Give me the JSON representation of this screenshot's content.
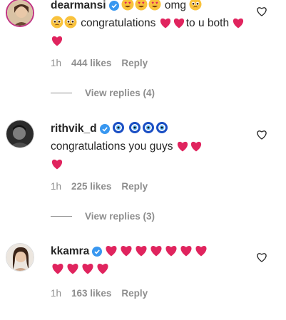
{
  "comments": [
    {
      "username": "dearmansi",
      "segments": [
        " omg ",
        " congratulations ",
        "to u both "
      ],
      "time": "1h",
      "likes": "444 likes",
      "reply": "Reply",
      "view_replies": "View replies (4)"
    },
    {
      "username": "rithvik_d",
      "segments": [
        "congratulations you guys "
      ],
      "time": "1h",
      "likes": "225 likes",
      "reply": "Reply",
      "view_replies": "View replies (3)"
    },
    {
      "username": "kkamra",
      "time": "1h",
      "likes": "163 likes",
      "reply": "Reply"
    }
  ],
  "colors": {
    "text": "#262626",
    "muted": "#8e8e8e",
    "verified": "#3897f0",
    "heart": "#e0245e"
  },
  "icons": [
    "verified-badge-icon",
    "heart-eyes-emoji",
    "pleading-face-emoji",
    "red-heart-emoji",
    "nazar-amulet-emoji",
    "heart-outline-icon"
  ]
}
